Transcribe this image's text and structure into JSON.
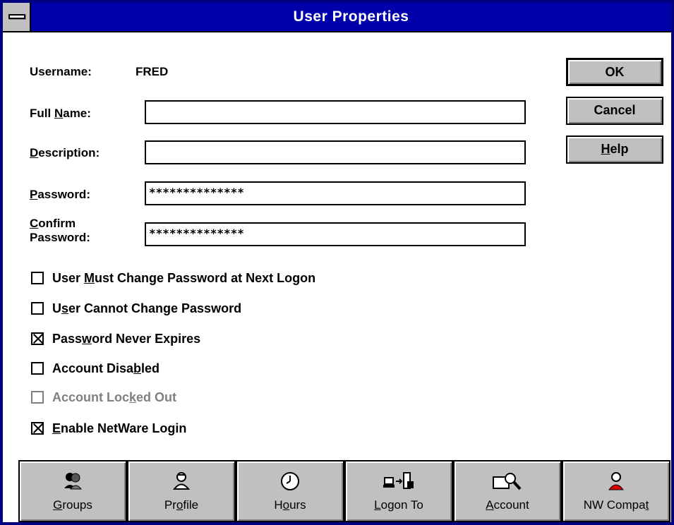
{
  "window": {
    "title": "User Properties"
  },
  "username": {
    "label": "Username:",
    "value": "FRED"
  },
  "fields": {
    "full_name": {
      "label_prefix": "Full ",
      "label_u": "N",
      "label_rest": "ame:",
      "value": ""
    },
    "description": {
      "label_u": "D",
      "label_rest": "escription:",
      "value": ""
    },
    "password": {
      "label_u": "P",
      "label_rest": "assword:",
      "value": "**************"
    },
    "confirm_password": {
      "label_u": "C",
      "label_line1_rest": "onfirm",
      "label_line2": "Password:",
      "value": "**************"
    }
  },
  "buttons": {
    "ok": "OK",
    "cancel": "Cancel",
    "help_u": "H",
    "help_rest": "elp"
  },
  "checkboxes": [
    {
      "pre": "User ",
      "u": "M",
      "post": "ust Change Password at Next Logon",
      "checked": false,
      "disabled": false
    },
    {
      "pre": "U",
      "u": "s",
      "post": "er Cannot Change Password",
      "checked": false,
      "disabled": false
    },
    {
      "pre": "Pass",
      "u": "w",
      "post": "ord Never Expires",
      "checked": true,
      "disabled": false
    },
    {
      "pre": "Account Disa",
      "u": "b",
      "post": "led",
      "checked": false,
      "disabled": false
    },
    {
      "pre": "Account Loc",
      "u": "k",
      "post": "ed Out",
      "checked": false,
      "disabled": true
    },
    {
      "pre": "",
      "u": "E",
      "post": "nable NetWare Login",
      "checked": true,
      "disabled": false
    }
  ],
  "toolbar": [
    {
      "pre": "",
      "u": "G",
      "post": "roups",
      "icon": "groups-icon"
    },
    {
      "pre": "Pr",
      "u": "o",
      "post": "file",
      "icon": "profile-icon"
    },
    {
      "pre": "H",
      "u": "o",
      "post": "urs",
      "icon": "clock-icon"
    },
    {
      "pre": "",
      "u": "L",
      "post": "ogon To",
      "icon": "logon-to-icon"
    },
    {
      "pre": "",
      "u": "A",
      "post": "ccount",
      "icon": "account-icon"
    },
    {
      "pre": "NW Compa",
      "u": "t",
      "post": "",
      "icon": "nw-compat-icon"
    }
  ],
  "colors": {
    "titlebar": "#0000aa",
    "face": "#c0c0c0",
    "frame": "#000080"
  }
}
